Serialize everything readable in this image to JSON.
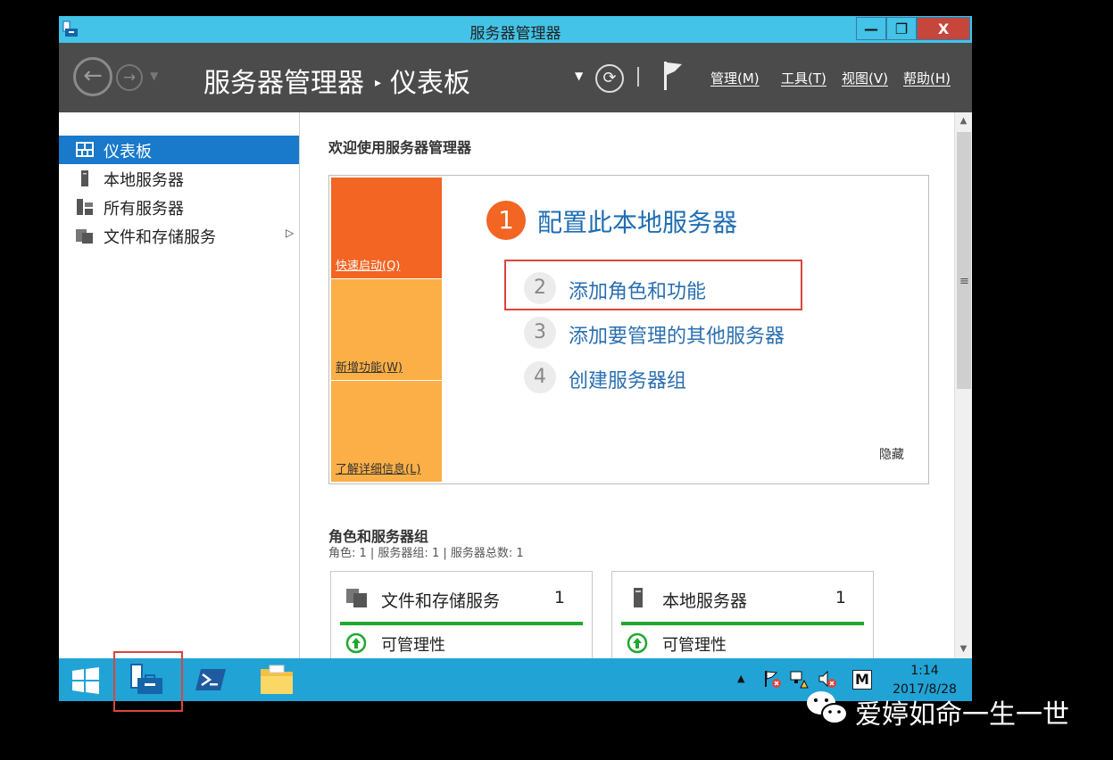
{
  "window": {
    "title": "服务器管理器"
  },
  "window_controls": {
    "minimize": "—",
    "maximize": "❐",
    "close": "X"
  },
  "commandbar": {
    "breadcrumb_root": "服务器管理器",
    "breadcrumb_separator": "▸",
    "breadcrumb_current": "仪表板",
    "menus": [
      "管理(M)",
      "工具(T)",
      "视图(V)",
      "帮助(H)"
    ]
  },
  "sidebar": {
    "items": [
      {
        "label": "仪表板",
        "icon": "dashboard-icon",
        "active": true
      },
      {
        "label": "本地服务器",
        "icon": "server-icon"
      },
      {
        "label": "所有服务器",
        "icon": "servers-icon"
      },
      {
        "label": "文件和存储服务",
        "icon": "storage-icon",
        "has_submenu": true
      }
    ]
  },
  "main": {
    "welcome_title": "欢迎使用服务器管理器",
    "quickstart": {
      "tiles": [
        "快速启动(Q)",
        "新增功能(W)",
        "了解详细信息(L)"
      ],
      "step1": {
        "number": "1",
        "label": "配置此本地服务器"
      },
      "steps": [
        {
          "number": "2",
          "label": "添加角色和功能"
        },
        {
          "number": "3",
          "label": "添加要管理的其他服务器"
        },
        {
          "number": "4",
          "label": "创建服务器组"
        }
      ],
      "hide": "隐藏"
    },
    "roles": {
      "title": "角色和服务器组",
      "subtitle": "角色: 1 | 服务器组: 1 | 服务器总数: 1",
      "cards": [
        {
          "name": "文件和存储服务",
          "count": "1",
          "status": "可管理性",
          "icon": "storage-icon"
        },
        {
          "name": "本地服务器",
          "count": "1",
          "status": "可管理性",
          "icon": "server-icon"
        }
      ]
    }
  },
  "taskbar": {
    "apps": [
      "windows-start-icon",
      "server-manager-icon",
      "powershell-icon",
      "file-explorer-icon"
    ],
    "tray": {
      "ime": "M",
      "time": "1:14",
      "date": "2017/8/28"
    }
  },
  "watermark": {
    "text": "爱婷如命一生一世"
  },
  "colors": {
    "titlebar": "#42c3e7",
    "cmdbar": "#4b4b4b",
    "active_nav": "#1979ca",
    "quickstart_orange": "#f26522",
    "tile_amber": "#fbaf46",
    "link_blue": "#2a6fb0",
    "highlight_red": "#d9453c",
    "status_green": "#1fa82f",
    "taskbar": "#21a3d6"
  }
}
